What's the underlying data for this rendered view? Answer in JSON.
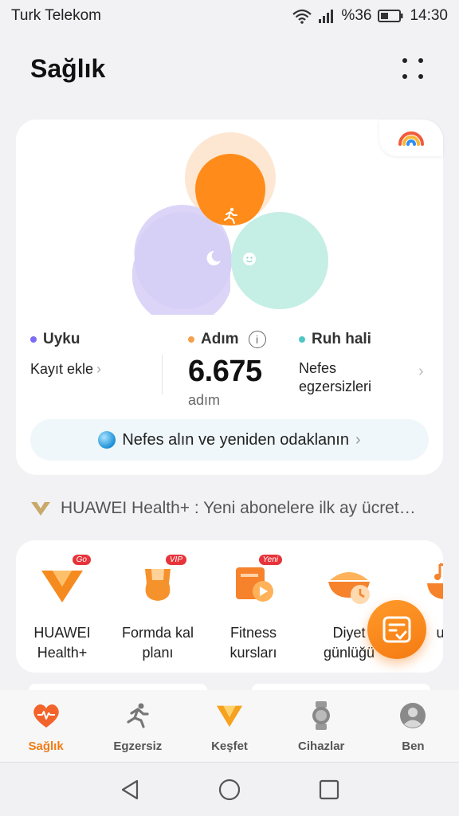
{
  "status_bar": {
    "carrier": "Turk Telekom",
    "battery": "%36",
    "time": "14:30"
  },
  "header": {
    "title": "Sağlık"
  },
  "summary": {
    "sleep": {
      "label": "Uyku",
      "action": "Kayıt ekle",
      "color": "#7b6cf6"
    },
    "steps": {
      "label": "Adım",
      "value": "6.675",
      "unit": "adım",
      "color": "#f5a04a"
    },
    "mood": {
      "label": "Ruh hali",
      "action_line1": "Nefes",
      "action_line2": "egzersizleri",
      "color": "#4ec7c4"
    },
    "banner": "Nefes alın ve yeniden odaklanın"
  },
  "promo": {
    "text": "HUAWEI Health+ :  Yeni abonelere ilk ay ücret…"
  },
  "services": [
    {
      "line1": "HUAWEI",
      "line2": "Health+",
      "badge": "Go"
    },
    {
      "line1": "Formda kal",
      "line2": "planı",
      "badge": "VIP"
    },
    {
      "line1": "Fitness",
      "line2": "kursları",
      "badge": "Yeni"
    },
    {
      "line1": "Diyet",
      "line2": "günlüğü",
      "badge": ""
    },
    {
      "line1": "u r",
      "line2": "",
      "badge": ""
    }
  ],
  "tabs": [
    {
      "label": "Sağlık",
      "icon": "heart-icon",
      "active": true
    },
    {
      "label": "Egzersiz",
      "icon": "running-icon",
      "active": false
    },
    {
      "label": "Keşfet",
      "icon": "discover-icon",
      "active": false
    },
    {
      "label": "Cihazlar",
      "icon": "watch-icon",
      "active": false
    },
    {
      "label": "Ben",
      "icon": "profile-icon",
      "active": false
    }
  ],
  "colors": {
    "accent": "#f07b14",
    "sleep": "#c9c0f5",
    "mood": "#bfece5",
    "steps": "#ff8c1a"
  }
}
